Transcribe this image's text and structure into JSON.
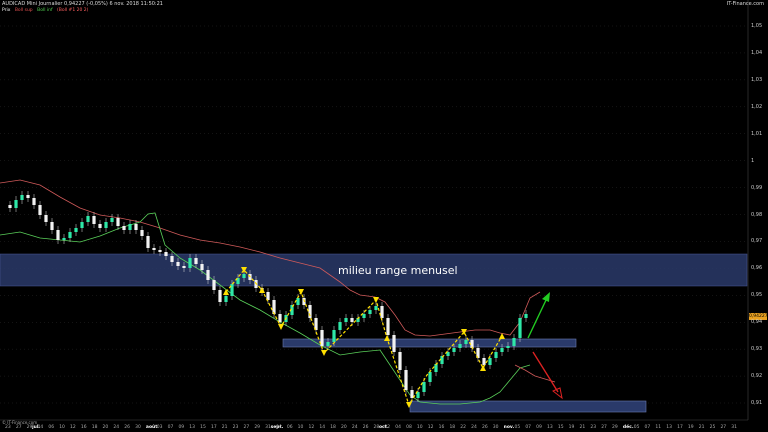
{
  "header": {
    "title": "AUDICAD Mini  Journalier  0,94227 (-0,05%)  6 nov. 2018 11:50:21",
    "brand": "IT-Finance.com"
  },
  "legend": [
    {
      "text": "Prix",
      "color": "#ffffff"
    },
    {
      "text": "Boll sup",
      "color": "#e05050"
    },
    {
      "text": "Boll inf",
      "color": "#50d050"
    },
    {
      "text": "(Boll #1 20 2)",
      "color": "#ff6060"
    }
  ],
  "copyright": "© IT-Finance.com",
  "annotation": {
    "label": "milieu range menusel"
  },
  "last_price": "0,94227",
  "axis": {
    "y_ticks": [
      "1,05",
      "1,04",
      "1,03",
      "1,02",
      "1,01",
      "1",
      "0,99",
      "0,98",
      "0,97",
      "0,96",
      "0,95",
      "0,94",
      "0,93",
      "0,92",
      "0,91"
    ],
    "x_ticks": [
      "23",
      "26",
      "27",
      "28",
      "29",
      "jul.",
      "04",
      "05",
      "06",
      "09",
      "10",
      "11",
      "12",
      "13",
      "16",
      "17",
      "18",
      "19",
      "20",
      "23",
      "24",
      "25",
      "26",
      "27",
      "30",
      "31",
      "août",
      "02",
      "03",
      "06",
      "07",
      "08",
      "09",
      "10",
      "13",
      "14",
      "15",
      "16",
      "17",
      "20",
      "21",
      "22",
      "23",
      "24",
      "27",
      "28",
      "29",
      "30",
      "31",
      "sept.",
      "04",
      "05",
      "06",
      "07",
      "10",
      "11",
      "12",
      "13",
      "14",
      "17",
      "18",
      "19",
      "20",
      "21",
      "24",
      "25",
      "26",
      "27",
      "28",
      "oct.",
      "02",
      "03",
      "04",
      "05",
      "08",
      "09",
      "10",
      "11",
      "12",
      "15",
      "16",
      "17",
      "18",
      "19",
      "22",
      "23",
      "24",
      "25",
      "26",
      "29",
      "30",
      "31",
      "nov.",
      "02",
      "05",
      "06",
      "07",
      "08",
      "09",
      "12",
      "13",
      "14",
      "15",
      "16",
      "19",
      "20",
      "21",
      "22",
      "23",
      "26",
      "27",
      "28",
      "29",
      "30",
      "déc.",
      "04",
      "05",
      "06",
      "07",
      "10",
      "11",
      "12",
      "13",
      "14",
      "17",
      "18",
      "19",
      "20",
      "21",
      "24",
      "25",
      "26",
      "27",
      "28",
      "31",
      "2019"
    ]
  },
  "chart_data": {
    "type": "candlestick",
    "instrument": "AUDICAD Mini",
    "timeframe": "Journalier",
    "ylim": [
      0.905,
      1.057
    ],
    "zones": [
      {
        "low": 0.9536,
        "high": 0.9661,
        "label": "milieu range menusel"
      },
      {
        "low": 0.9309,
        "high": 0.9326
      },
      {
        "low": 0.9055,
        "high": 0.9095
      }
    ],
    "y_samples": {
      "last_close": 0.94227,
      "swing_high_early": 0.9895,
      "swing_low_oct": 0.9105,
      "nov_high": 0.9495
    }
  }
}
